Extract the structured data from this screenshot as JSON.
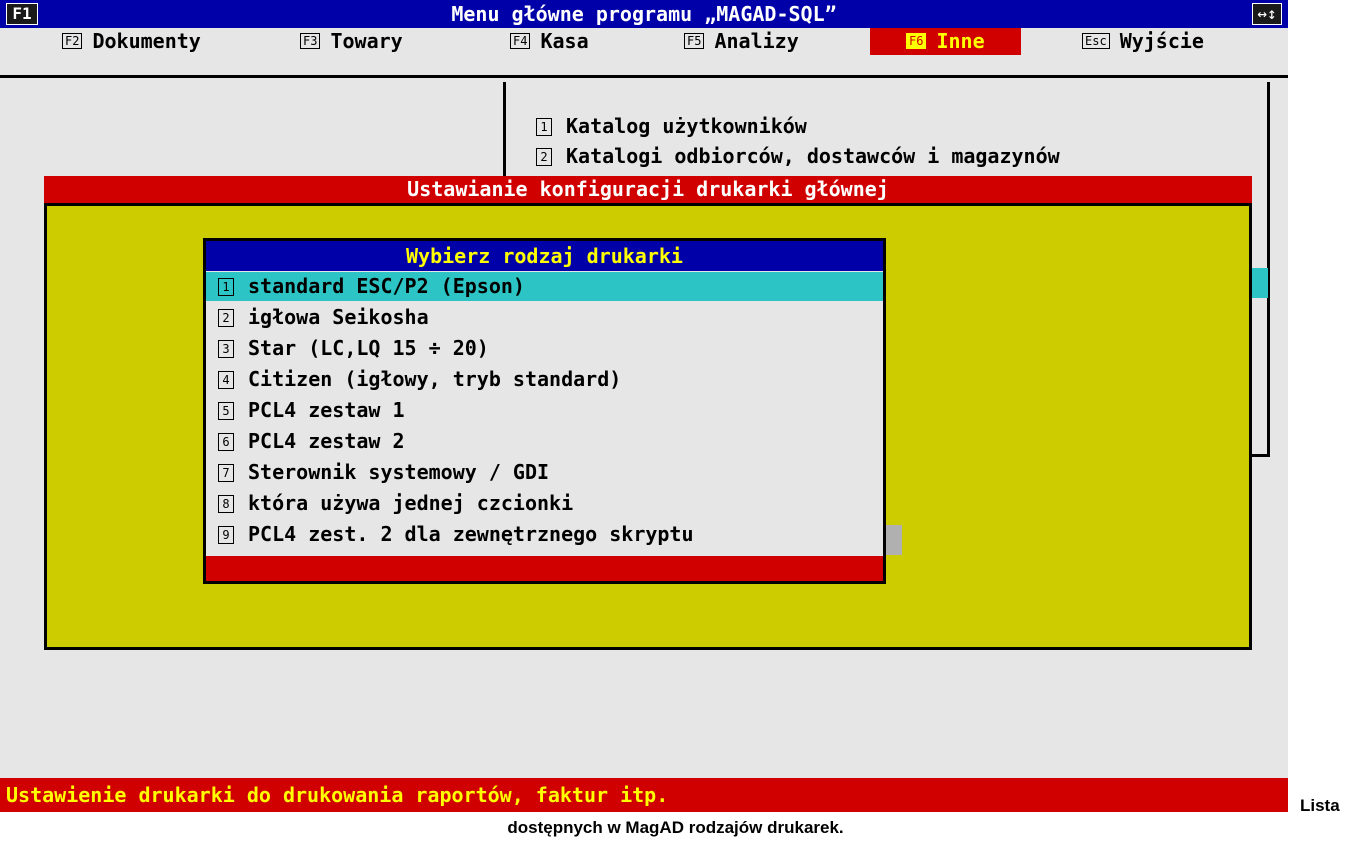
{
  "titlebar": {
    "f1_label": "F1",
    "title": "Menu główne programu „MAGAD-SQL”",
    "resize_icon": "↔↕"
  },
  "menu": [
    {
      "key": "F2",
      "label": "Dokumenty"
    },
    {
      "key": "F3",
      "label": "Towary"
    },
    {
      "key": "F4",
      "label": "Kasa"
    },
    {
      "key": "F5",
      "label": "Analizy"
    },
    {
      "key": "F6",
      "label": "Inne",
      "active": true
    },
    {
      "key": "Esc",
      "label": "Wyjście"
    }
  ],
  "submenu": [
    {
      "num": "1",
      "label": "Katalog użytkowników"
    },
    {
      "num": "2",
      "label": "Katalogi odbiorców, dostawców i magazynów"
    }
  ],
  "config_window": {
    "title": "Ustawianie konfiguracji drukarki głównej"
  },
  "picker": {
    "title": "Wybierz rodzaj drukarki",
    "options": [
      {
        "num": "1",
        "label": "standard ESC/P2 (Epson)",
        "selected": true
      },
      {
        "num": "2",
        "label": "igłowa Seikosha"
      },
      {
        "num": "3",
        "label": "Star (LC,LQ 15 ÷ 20)"
      },
      {
        "num": "4",
        "label": "Citizen (igłowy, tryb standard)"
      },
      {
        "num": "5",
        "label": "PCL4 zestaw 1"
      },
      {
        "num": "6",
        "label": "PCL4 zestaw 2"
      },
      {
        "num": "7",
        "label": "Sterownik systemowy / GDI"
      },
      {
        "num": "8",
        "label": "która używa jednej czcionki"
      },
      {
        "num": "9",
        "label": "PCL4 zest. 2 dla zewnętrznego skryptu"
      }
    ]
  },
  "statusbar": {
    "text": "Ustawienie drukarki do drukowania raportów, faktur itp."
  },
  "caption": {
    "line1": "Lista",
    "line2": "dostępnych w MagAD rodzajów drukarek."
  },
  "colors": {
    "blue": "#0000a8",
    "red": "#d00000",
    "yellow": "#ffff00",
    "olive": "#cccc00",
    "cyan": "#2cc4c4",
    "gray": "#e6e6e6"
  }
}
